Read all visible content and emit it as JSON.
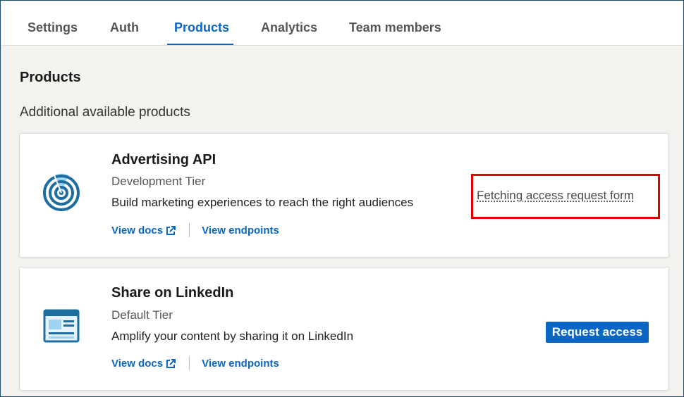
{
  "tabs": [
    {
      "label": "Settings"
    },
    {
      "label": "Auth"
    },
    {
      "label": "Products"
    },
    {
      "label": "Analytics"
    },
    {
      "label": "Team members"
    }
  ],
  "active_tab": "Products",
  "section": {
    "title": "Products",
    "subtitle": "Additional available products"
  },
  "products": [
    {
      "name": "Advertising API",
      "tier": "Development Tier",
      "description": "Build marketing experiences to reach the right audiences",
      "view_docs": "View docs",
      "view_endpoints": "View endpoints",
      "status_text": "Fetching access request form",
      "icon": "radar-target-icon"
    },
    {
      "name": "Share on LinkedIn",
      "tier": "Default Tier",
      "description": "Amplify your content by sharing it on LinkedIn",
      "view_docs": "View docs",
      "view_endpoints": "View endpoints",
      "action_label": "Request access",
      "icon": "share-post-icon"
    }
  ],
  "colors": {
    "accent": "#0a66c2",
    "highlight_border": "#e00000",
    "background": "#f3f2ef"
  }
}
